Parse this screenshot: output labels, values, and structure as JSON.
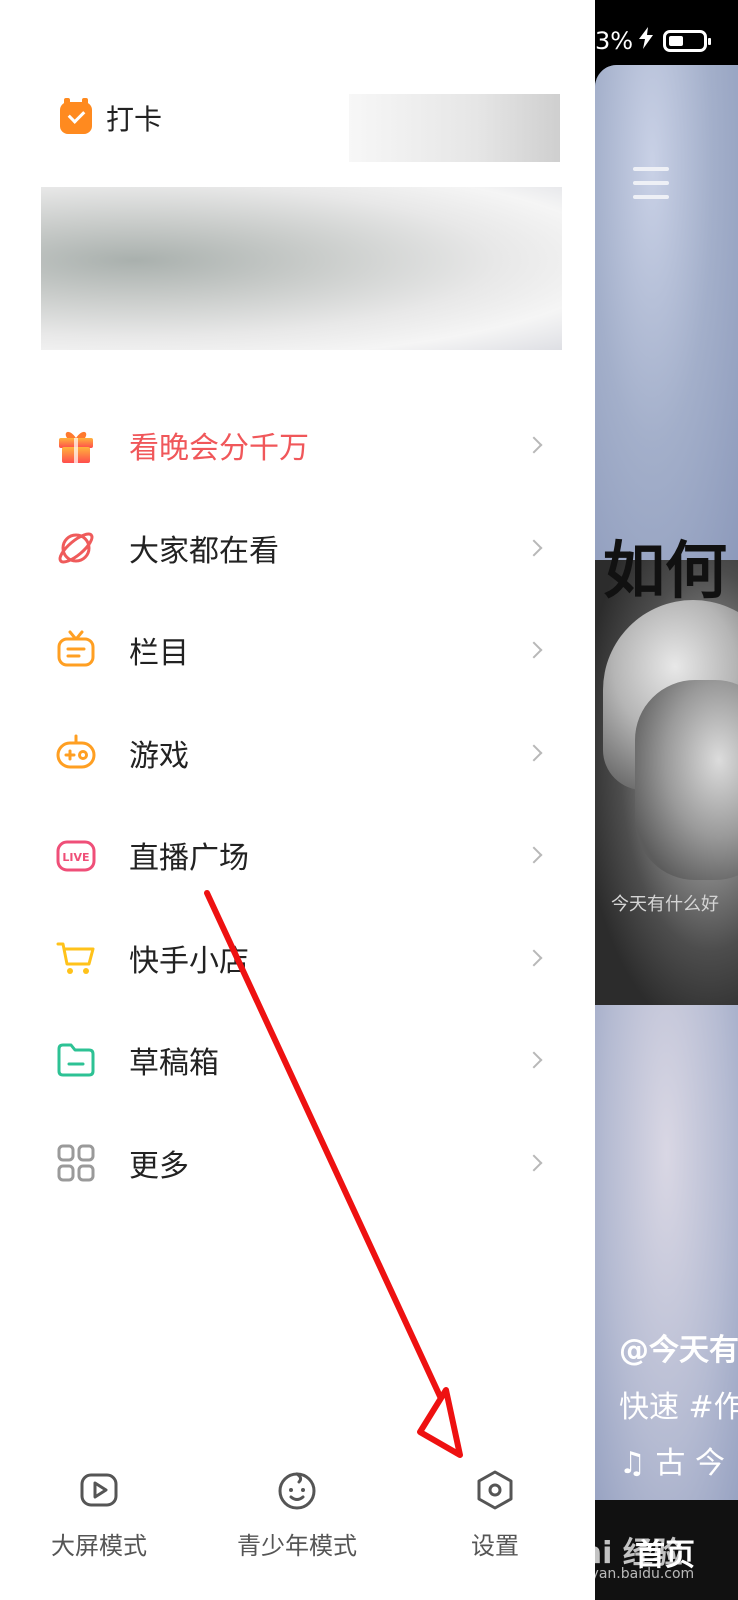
{
  "status_bar": {
    "battery_text": "3%",
    "charging_icon": "lightning-icon"
  },
  "drawer": {
    "checkin": {
      "label": "打卡",
      "icon": "alarm-check-icon",
      "color": "#ff8a1f"
    },
    "menu": [
      {
        "label": "看晚会分千万",
        "icon": "gift-icon",
        "highlight": true
      },
      {
        "label": "大家都在看",
        "icon": "planet-icon"
      },
      {
        "label": "栏目",
        "icon": "tv-icon"
      },
      {
        "label": "游戏",
        "icon": "gamepad-icon"
      },
      {
        "label": "直播广场",
        "icon": "live-icon"
      },
      {
        "label": "快手小店",
        "icon": "cart-icon"
      },
      {
        "label": "草稿箱",
        "icon": "folder-icon"
      },
      {
        "label": "更多",
        "icon": "grid-icon"
      }
    ],
    "bottom": [
      {
        "label": "大屏模式",
        "icon": "play-screen-icon"
      },
      {
        "label": "青少年模式",
        "icon": "child-face-icon"
      },
      {
        "label": "设置",
        "icon": "settings-hex-icon"
      }
    ]
  },
  "background_app": {
    "headline": "如何",
    "photo_caption": "今天有什么好",
    "author": "@今天有",
    "description": "快速 #作",
    "music": "♫ 古   今",
    "tab_label": "首页",
    "watermark": "Bai 经验",
    "watermark_sub": "jingyan.baidu.com"
  },
  "colors": {
    "accent_red": "#f0575a",
    "orange": "#ff8a1f",
    "annotation_arrow": "#ee1111"
  }
}
